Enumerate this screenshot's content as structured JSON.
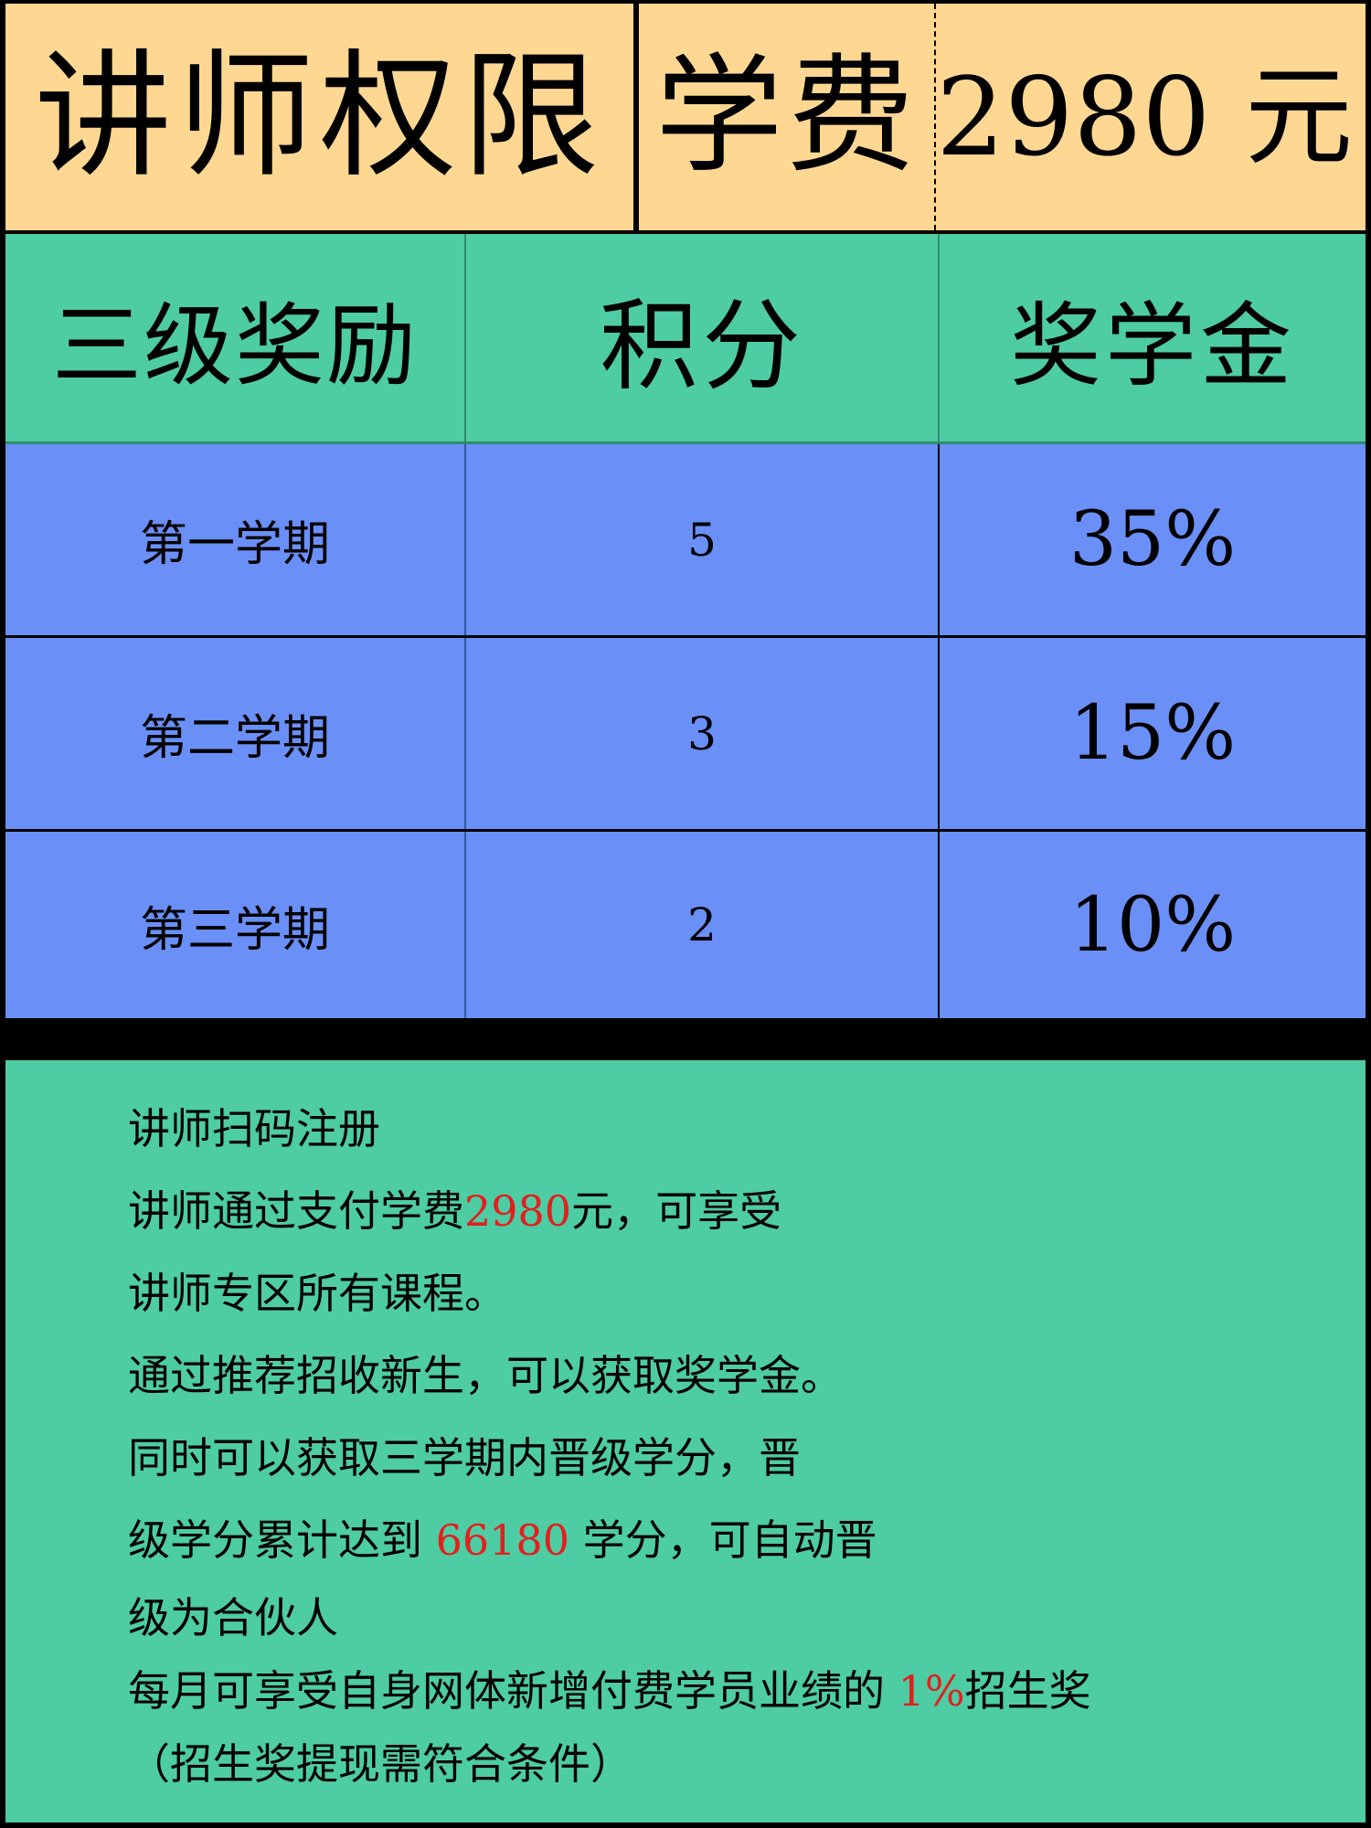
{
  "header": {
    "title": "讲师权限",
    "fee_label": "学费",
    "fee_value": "2980 元"
  },
  "table": {
    "columns": [
      "三级奖励",
      "积分",
      "奖学金"
    ],
    "rows": [
      {
        "term": "第一学期",
        "points": "5",
        "scholarship": "35%"
      },
      {
        "term": "第二学期",
        "points": "3",
        "scholarship": "15%"
      },
      {
        "term": "第三学期",
        "points": "2",
        "scholarship": "10%"
      }
    ]
  },
  "info": {
    "line1": "讲师扫码注册",
    "line2_pre": "讲师通过支付学费",
    "line2_highlight": "2980",
    "line2_post": "元，可享受",
    "line3": "讲师专区所有课程。",
    "line4": "通过推荐招收新生，可以获取奖学金。",
    "line5": "同时可以获取三学期内晋级学分，晋",
    "line6_pre": "级学分累计达到 ",
    "line6_highlight": "66180",
    "line6_post": " 学分，可自动晋",
    "line7": "级为合伙人",
    "line8_pre": "每月可享受自身网体新增付费学员业绩的 ",
    "line8_highlight": "1%",
    "line8_post": "招生奖",
    "line9": "（招生奖提现需符合条件）"
  },
  "colors": {
    "header_bg": "#FED793",
    "table_head_bg": "#4ECCA3",
    "table_row_bg": "#6A8FF7",
    "info_bg": "#4ECCA3",
    "highlight": "#e21f1f"
  }
}
